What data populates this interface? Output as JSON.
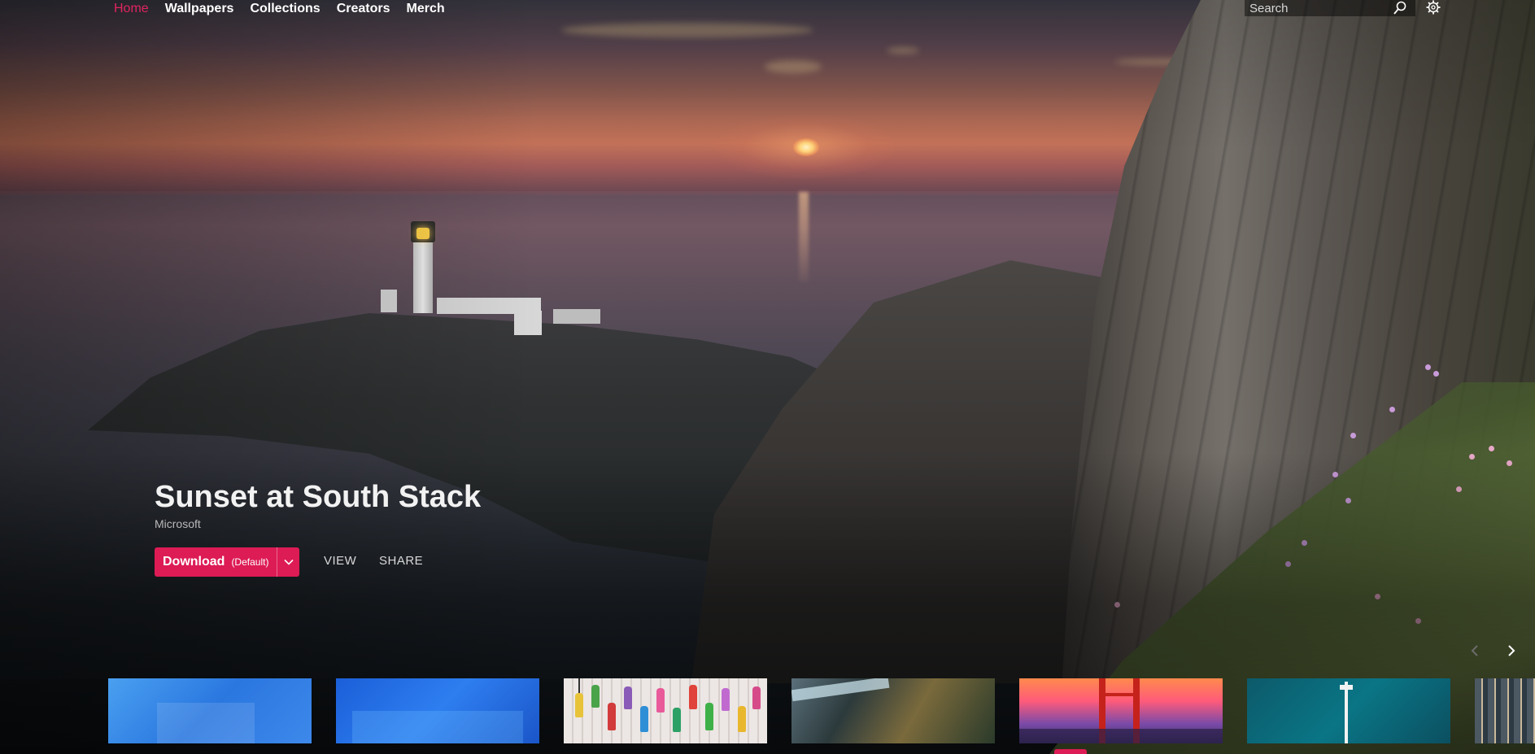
{
  "nav": {
    "items": [
      {
        "label": "Home",
        "active": true
      },
      {
        "label": "Wallpapers",
        "active": false
      },
      {
        "label": "Collections",
        "active": false
      },
      {
        "label": "Creators",
        "active": false
      },
      {
        "label": "Merch",
        "active": false
      }
    ]
  },
  "search": {
    "placeholder": "Search",
    "value": ""
  },
  "icons": {
    "search": "search-icon",
    "settings": "gear-icon",
    "dropdown": "chevron-down-icon",
    "prev": "chevron-left-icon",
    "next": "chevron-right-icon"
  },
  "hero": {
    "title": "Sunset at South Stack",
    "author": "Microsoft",
    "download_label": "Download",
    "download_sub": "(Default)",
    "view_label": "VIEW",
    "share_label": "SHARE"
  },
  "colors": {
    "accent": "#dd1b55",
    "active_nav": "#e0245e"
  }
}
